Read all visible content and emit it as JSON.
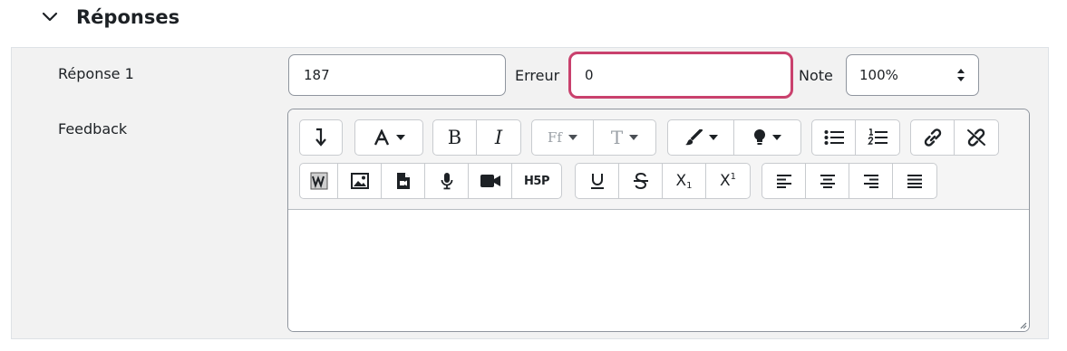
{
  "section": {
    "title": "Réponses"
  },
  "answer": {
    "label": "Réponse 1",
    "value": "187",
    "error_label": "Erreur",
    "error_value": "0",
    "grade_label": "Note",
    "grade_value": "100%"
  },
  "feedback": {
    "label": "Feedback"
  },
  "toolbar": {
    "bold_text": "B",
    "italic_text": "I",
    "font_family_text": "Ff",
    "font_size_text": "T",
    "h5p_text": "H5P",
    "subscript_text": "X",
    "subscript_digit": "1",
    "superscript_text": "X",
    "superscript_digit": "1"
  },
  "colors": {
    "focus_border": "#c9416d",
    "panel_bg": "#f2f2f2"
  }
}
